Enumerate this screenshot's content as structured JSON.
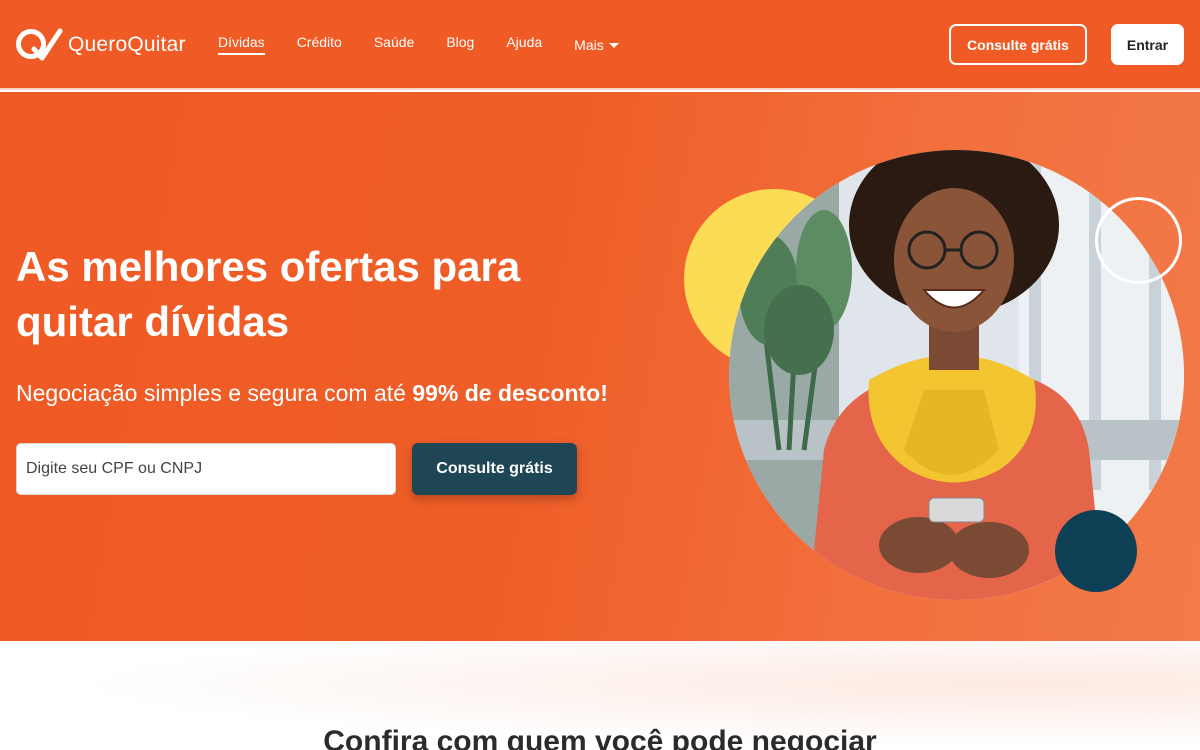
{
  "brand": {
    "name": "QueroQuitar",
    "color": "#f05a24",
    "dark": "#1f4654"
  },
  "nav": {
    "items": [
      {
        "label": "Dívidas",
        "active": true
      },
      {
        "label": "Crédito",
        "active": false
      },
      {
        "label": "Saúde",
        "active": false
      },
      {
        "label": "Blog",
        "active": false
      },
      {
        "label": "Ajuda",
        "active": false
      }
    ],
    "more_label": "Mais"
  },
  "header": {
    "cta_label": "Consulte grátis",
    "login_label": "Entrar"
  },
  "hero": {
    "title": "As melhores ofertas para quitar dívidas",
    "subtitle_prefix": "Negociação simples e segura com até ",
    "subtitle_highlight": "99% de desconto!",
    "input_placeholder": "Digite seu CPF ou CNPJ",
    "button_label": "Consulte grátis"
  },
  "section": {
    "title": "Confira com quem você pode negociar"
  },
  "icons": {
    "dropdown": "chevron-down-icon",
    "logo": "queroquitar-logo-icon"
  }
}
